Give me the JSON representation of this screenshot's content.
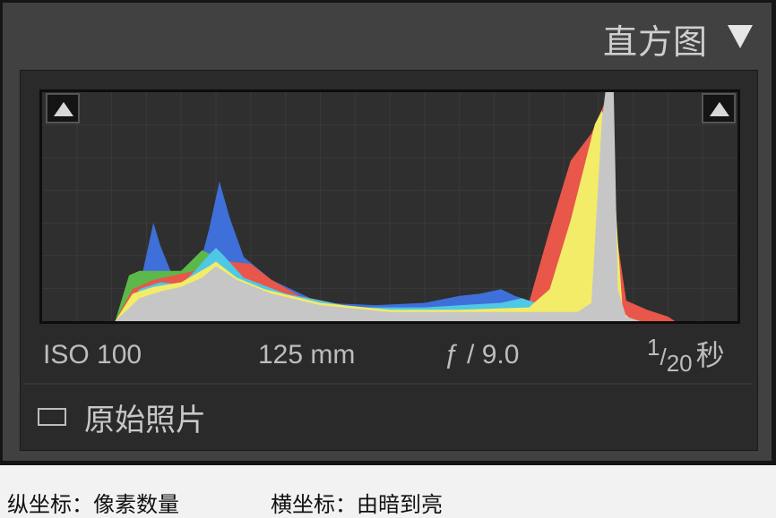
{
  "panel": {
    "title": "直方图",
    "collapse_icon": "triangle-down-icon",
    "exif": {
      "iso": "ISO 100",
      "focal_length": "125 mm",
      "aperture": "ƒ / 9.0",
      "shutter_numerator": "1",
      "shutter_slash": "/",
      "shutter_denominator": "20",
      "shutter_unit": "秒"
    },
    "original_photo_label": "原始照片",
    "original_photo_checked": false,
    "shadow_clip_icon": "shadow-clipping-triangle-icon",
    "highlight_clip_icon": "highlight-clipping-triangle-icon"
  },
  "captions": {
    "y_axis": "纵坐标：像素数量",
    "x_axis": "横坐标：由暗到亮"
  },
  "chart_data": {
    "type": "area",
    "x_range": [
      0,
      100
    ],
    "y_range": [
      0,
      100
    ],
    "grid": true,
    "colors": {
      "red": "#e8574a",
      "green": "#5cb84a",
      "blue": "#3f6fd8",
      "cyan": "#4fc8e6",
      "yellow": "#f2ec68",
      "gray": "#c6c6c6"
    },
    "series": [
      {
        "color_key": "blue",
        "points": [
          [
            10.5,
            0
          ],
          [
            14,
            15
          ],
          [
            16,
            43
          ],
          [
            17,
            33
          ],
          [
            19,
            18
          ],
          [
            22,
            17
          ],
          [
            24,
            40
          ],
          [
            25.5,
            61
          ],
          [
            27,
            45
          ],
          [
            29,
            28
          ],
          [
            33,
            18
          ],
          [
            40,
            8
          ],
          [
            48,
            7
          ],
          [
            55,
            8
          ],
          [
            60,
            11
          ],
          [
            63,
            12
          ],
          [
            66,
            14
          ],
          [
            68,
            11
          ],
          [
            71,
            8
          ],
          [
            74,
            5
          ],
          [
            76,
            3
          ],
          [
            82,
            3
          ],
          [
            84,
            0
          ]
        ]
      },
      {
        "color_key": "green",
        "points": [
          [
            10.5,
            0
          ],
          [
            12.5,
            20
          ],
          [
            14,
            22
          ],
          [
            17,
            22
          ],
          [
            20,
            22
          ],
          [
            23,
            31
          ],
          [
            25,
            28
          ],
          [
            27,
            25
          ],
          [
            30,
            19
          ],
          [
            35,
            11
          ],
          [
            45,
            6
          ],
          [
            55,
            5
          ],
          [
            62,
            5
          ],
          [
            70,
            6
          ],
          [
            72,
            15
          ],
          [
            75,
            21
          ],
          [
            78,
            12
          ],
          [
            80,
            0
          ]
        ]
      },
      {
        "color_key": "red",
        "points": [
          [
            10.5,
            0
          ],
          [
            13,
            14
          ],
          [
            16,
            18
          ],
          [
            19,
            20
          ],
          [
            22,
            22
          ],
          [
            25,
            27
          ],
          [
            27,
            26
          ],
          [
            30,
            25
          ],
          [
            33,
            18
          ],
          [
            37,
            11
          ],
          [
            45,
            6
          ],
          [
            55,
            5
          ],
          [
            70,
            8
          ],
          [
            73,
            40
          ],
          [
            76,
            70
          ],
          [
            79,
            82
          ],
          [
            81,
            96
          ],
          [
            82.5,
            40
          ],
          [
            84,
            9
          ],
          [
            87,
            5
          ],
          [
            90,
            2
          ],
          [
            91,
            0
          ]
        ]
      },
      {
        "color_key": "cyan",
        "points": [
          [
            10.5,
            0
          ],
          [
            14,
            14
          ],
          [
            17,
            17
          ],
          [
            20,
            16
          ],
          [
            22,
            22
          ],
          [
            24,
            29
          ],
          [
            25,
            32
          ],
          [
            26,
            29
          ],
          [
            29,
            19
          ],
          [
            35,
            12
          ],
          [
            45,
            6
          ],
          [
            55,
            6
          ],
          [
            66,
            8
          ],
          [
            69,
            10
          ],
          [
            72,
            7
          ],
          [
            73,
            2
          ],
          [
            78,
            2
          ],
          [
            80,
            0
          ]
        ]
      },
      {
        "color_key": "yellow",
        "points": [
          [
            10.5,
            0
          ],
          [
            13,
            12
          ],
          [
            16,
            15
          ],
          [
            20,
            17
          ],
          [
            24,
            24
          ],
          [
            25,
            26
          ],
          [
            28,
            19
          ],
          [
            32,
            14
          ],
          [
            40,
            8
          ],
          [
            50,
            5
          ],
          [
            60,
            5
          ],
          [
            70,
            6
          ],
          [
            73,
            14
          ],
          [
            76,
            44
          ],
          [
            78,
            68
          ],
          [
            79.5,
            86
          ],
          [
            80.5,
            92
          ],
          [
            82,
            76
          ],
          [
            82.8,
            35
          ],
          [
            83.5,
            4
          ],
          [
            85,
            0
          ]
        ]
      },
      {
        "color_key": "gray",
        "points": [
          [
            10.5,
            0
          ],
          [
            14,
            10
          ],
          [
            17,
            13
          ],
          [
            20,
            15
          ],
          [
            23,
            19
          ],
          [
            25,
            24
          ],
          [
            28,
            18
          ],
          [
            33,
            12
          ],
          [
            40,
            7
          ],
          [
            50,
            4
          ],
          [
            60,
            4
          ],
          [
            70,
            4
          ],
          [
            74,
            4
          ],
          [
            77,
            4
          ],
          [
            79,
            8
          ],
          [
            80.5,
            88
          ],
          [
            81,
            100
          ],
          [
            82.2,
            100
          ],
          [
            82.8,
            14
          ],
          [
            84,
            2
          ],
          [
            86,
            0
          ]
        ]
      }
    ]
  }
}
